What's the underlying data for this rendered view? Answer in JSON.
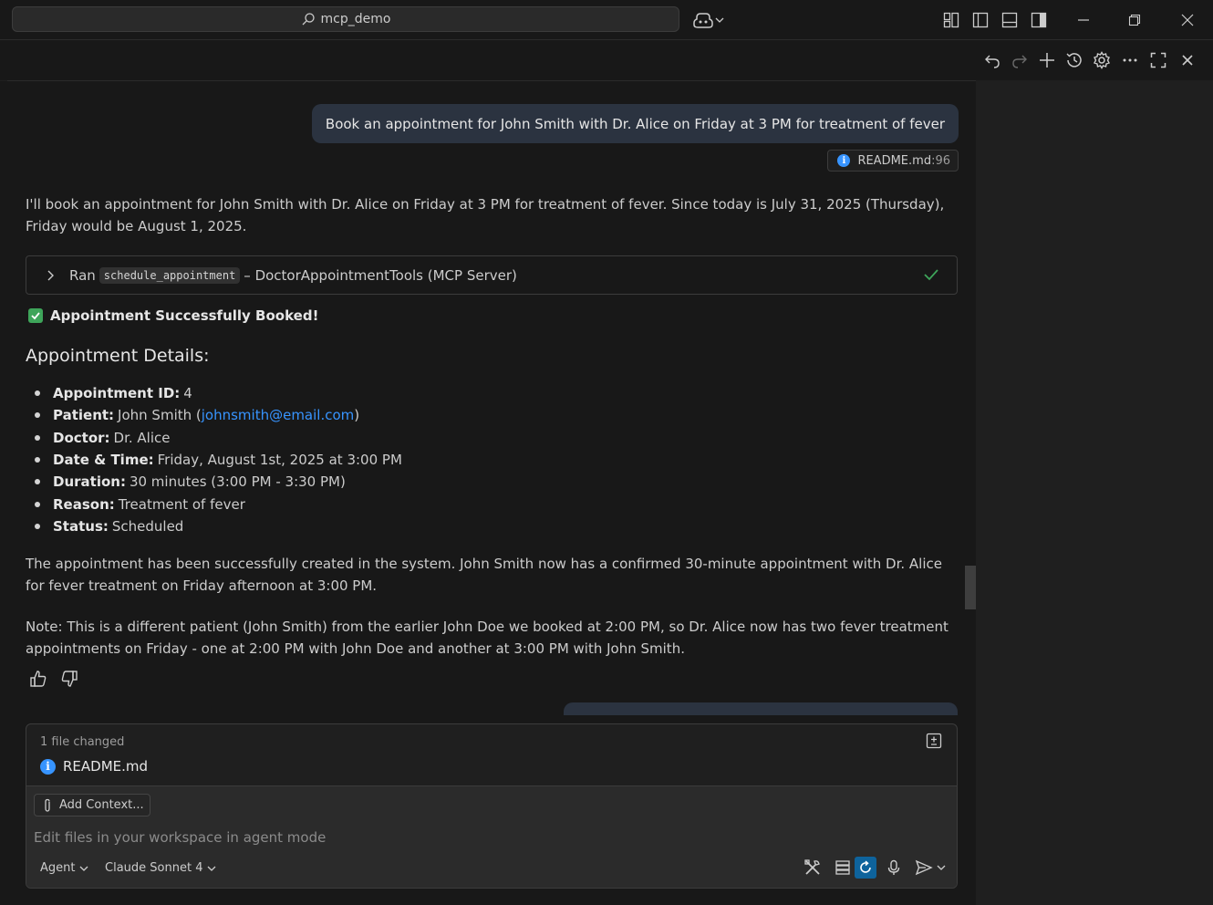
{
  "titlebar": {
    "search_text": "mcp_demo"
  },
  "chat": {
    "user_message": "Book an appointment for John Smith with Dr. Alice on Friday at 3 PM for treatment of fever",
    "reference": {
      "file": "README.md",
      "line": ":96"
    },
    "intro": "I'll book an appointment for John Smith with Dr. Alice on Friday at 3 PM for treatment of fever. Since today is July 31, 2025 (Thursday), Friday would be August 1, 2025.",
    "tool_call": {
      "prefix": "Ran",
      "tool_name": "schedule_appointment",
      "suffix": "– DoctorAppointmentTools (MCP Server)"
    },
    "success_text": "Appointment Successfully Booked!",
    "details_heading": "Appointment Details:",
    "details": [
      {
        "label": "Appointment ID:",
        "value": "4"
      },
      {
        "label": "Patient:",
        "value": "John Smith (",
        "link": "johnsmith@email.com",
        "after": ")"
      },
      {
        "label": "Doctor:",
        "value": "Dr. Alice"
      },
      {
        "label": "Date & Time:",
        "value": "Friday, August 1st, 2025 at 3:00 PM"
      },
      {
        "label": "Duration:",
        "value": "30 minutes (3:00 PM - 3:30 PM)"
      },
      {
        "label": "Reason:",
        "value": "Treatment of fever"
      },
      {
        "label": "Status:",
        "value": "Scheduled"
      }
    ],
    "paragraph_1": "The appointment has been successfully created in the system. John Smith now has a confirmed 30-minute appointment with Dr. Alice for fever treatment on Friday afternoon at 3:00 PM.",
    "paragraph_2": "Note: This is a different patient (John Smith) from the earlier John Doe we booked at 2:00 PM, so Dr. Alice now has two fever treatment appointments on Friday - one at 2:00 PM with John Doe and another at 3:00 PM with John Smith."
  },
  "input": {
    "files_changed": "1 file changed",
    "changed_file": "README.md",
    "add_context": "Add Context...",
    "placeholder": "Edit files in your workspace in agent mode",
    "mode": "Agent",
    "model": "Claude Sonnet 4"
  },
  "colors": {
    "accent": "#3794ff",
    "success": "#3ea55a",
    "user_bubble": "#2b3340"
  }
}
